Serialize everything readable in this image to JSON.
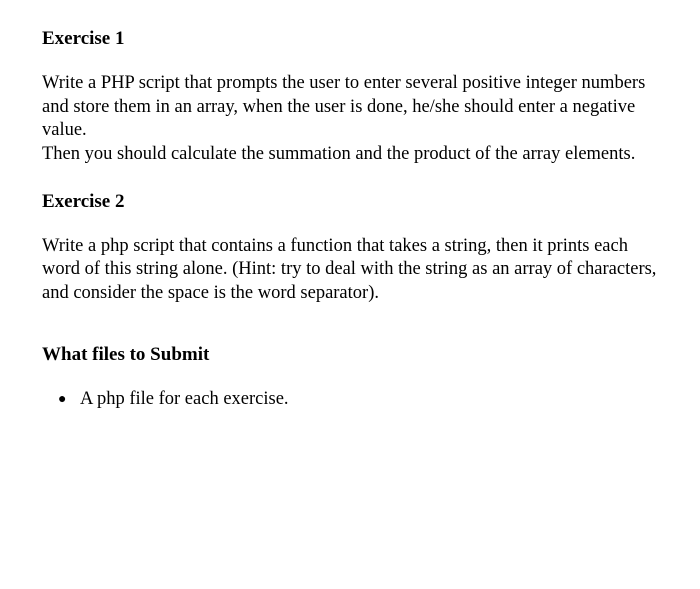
{
  "exercise1": {
    "heading": "Exercise 1",
    "body": "Write a PHP script that prompts the user to enter several positive integer numbers and store them in an array, when the user is done, he/she should enter a negative value.\nThen you should calculate the summation and the product of the array elements."
  },
  "exercise2": {
    "heading": "Exercise 2",
    "body": "Write a php script that contains a function that takes a string, then it prints each word of this string alone. (Hint: try to deal with the string as an array of characters, and consider the space is the word separator)."
  },
  "submit": {
    "heading": "What files to Submit",
    "items": [
      "A php file for each exercise."
    ]
  }
}
